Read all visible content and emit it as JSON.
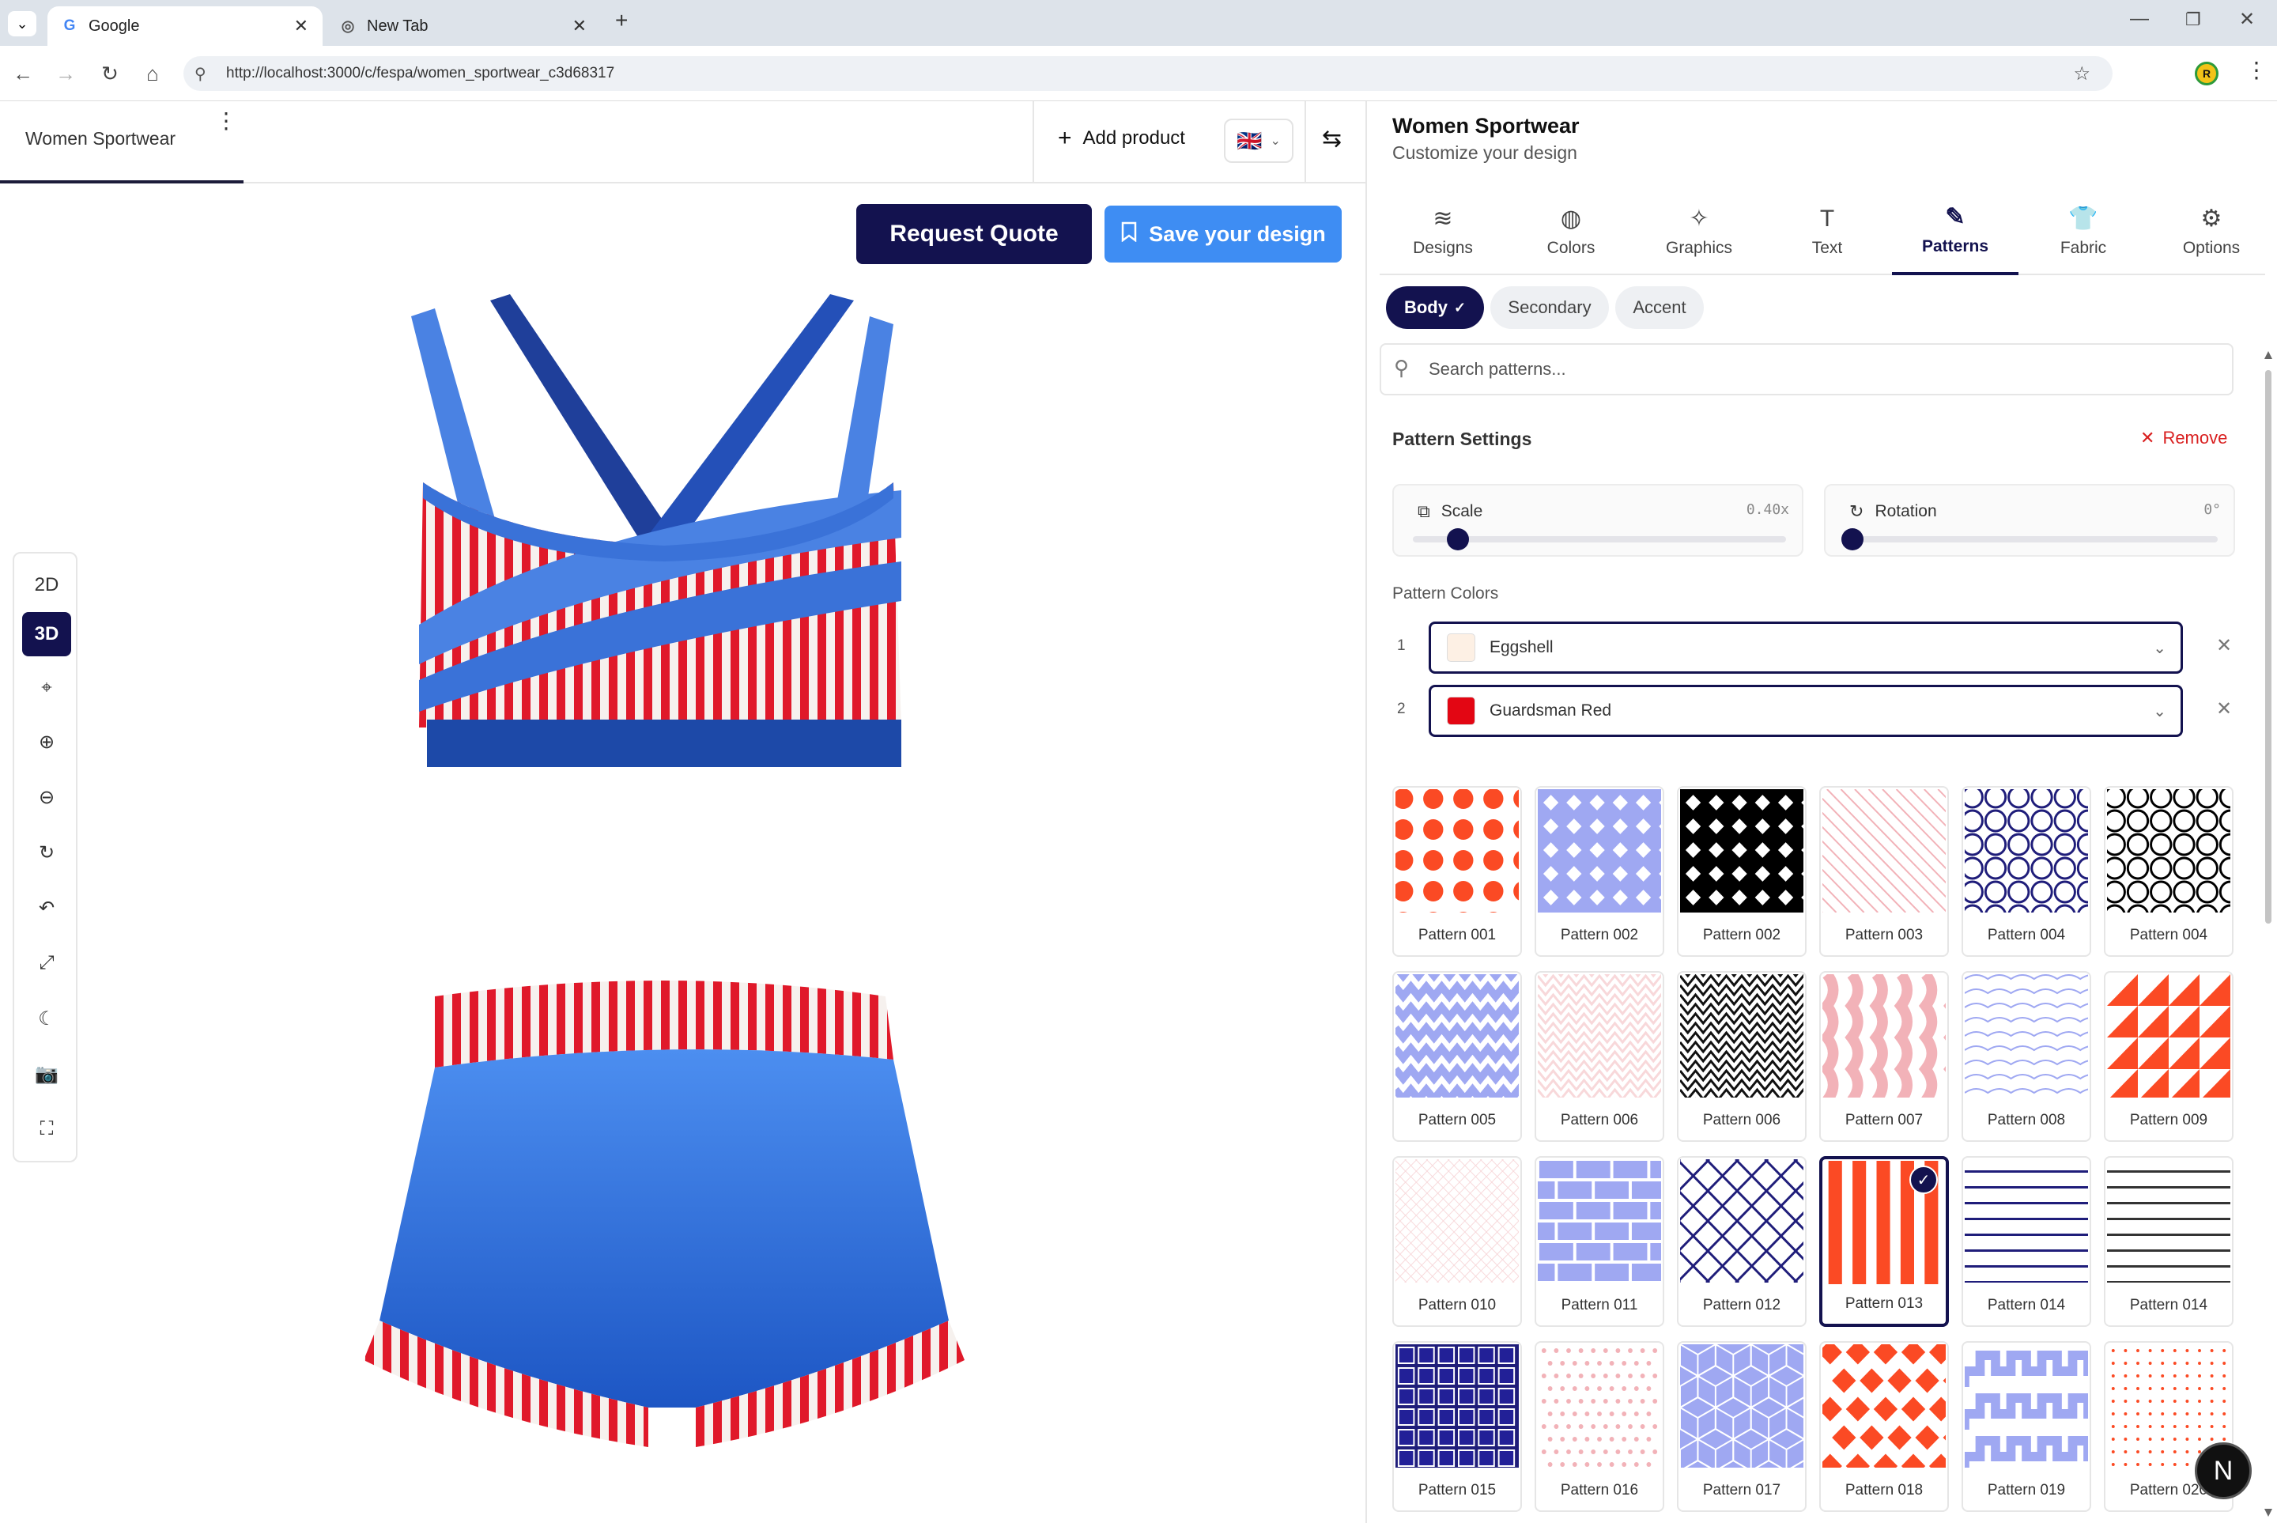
{
  "browser": {
    "tabs": [
      {
        "title": "Google",
        "active": true
      },
      {
        "title": "New Tab",
        "active": false
      }
    ],
    "url": "http://localhost:3000/c/fespa/women_sportwear_c3d68317"
  },
  "app": {
    "left_tab": "Women Sportwear",
    "add_product": "Add product",
    "language_flag": "🇬🇧",
    "request_quote": "Request Quote",
    "save_design": "Save your design",
    "view_modes": [
      "2D",
      "3D"
    ],
    "active_view": "3D"
  },
  "panel": {
    "title": "Women Sportwear",
    "subtitle": "Customize your design",
    "tabs": [
      {
        "label": "Designs",
        "icon": "layers-icon",
        "glyph": "≋"
      },
      {
        "label": "Colors",
        "icon": "palette-icon",
        "glyph": "◍"
      },
      {
        "label": "Graphics",
        "icon": "sparkles-icon",
        "glyph": "✧"
      },
      {
        "label": "Text",
        "icon": "text-icon",
        "glyph": "T"
      },
      {
        "label": "Patterns",
        "icon": "pen-tool-icon",
        "glyph": "✎"
      },
      {
        "label": "Fabric",
        "icon": "shirt-icon",
        "glyph": "👕"
      },
      {
        "label": "Options",
        "icon": "sliders-icon",
        "glyph": "⚙"
      }
    ],
    "active_tab": "Patterns",
    "zones": [
      "Body",
      "Secondary",
      "Accent"
    ],
    "active_zone": "Body",
    "search_placeholder": "Search patterns...",
    "pattern_settings_label": "Pattern Settings",
    "remove_label": "Remove",
    "scale": {
      "label": "Scale",
      "value_text": "0.40x",
      "fraction": 0.12
    },
    "rotation": {
      "label": "Rotation",
      "value_text": "0°",
      "fraction": 0.0
    },
    "pattern_colors_label": "Pattern Colors",
    "pattern_colors": [
      {
        "index": "1",
        "name": "Eggshell",
        "hex": "#fdf0e4"
      },
      {
        "index": "2",
        "name": "Guardsman Red",
        "hex": "#e30613"
      }
    ],
    "patterns": [
      {
        "label": "Pattern 001",
        "kind": "dots-red"
      },
      {
        "label": "Pattern 002",
        "kind": "diamond-lilac"
      },
      {
        "label": "Pattern 002",
        "kind": "diamond-black"
      },
      {
        "label": "Pattern 003",
        "kind": "diag-pink"
      },
      {
        "label": "Pattern 004",
        "kind": "circles-navy"
      },
      {
        "label": "Pattern 004",
        "kind": "circles-black"
      },
      {
        "label": "Pattern 005",
        "kind": "chevron-lilac"
      },
      {
        "label": "Pattern 006",
        "kind": "chevron-pink"
      },
      {
        "label": "Pattern 006",
        "kind": "chevron-black"
      },
      {
        "label": "Pattern 007",
        "kind": "wave-pink"
      },
      {
        "label": "Pattern 008",
        "kind": "wave-lilac"
      },
      {
        "label": "Pattern 009",
        "kind": "triangles-red"
      },
      {
        "label": "Pattern 010",
        "kind": "grid-pink"
      },
      {
        "label": "Pattern 011",
        "kind": "bricks-lilac"
      },
      {
        "label": "Pattern 012",
        "kind": "lattice-navy"
      },
      {
        "label": "Pattern 013",
        "kind": "stripes-red",
        "selected": true
      },
      {
        "label": "Pattern 014",
        "kind": "hlines-navy"
      },
      {
        "label": "Pattern 014",
        "kind": "hlines-black"
      },
      {
        "label": "Pattern 015",
        "kind": "grid-navy"
      },
      {
        "label": "Pattern 016",
        "kind": "dots-pink"
      },
      {
        "label": "Pattern 017",
        "kind": "cubes-lilac"
      },
      {
        "label": "Pattern 018",
        "kind": "diamonds-red"
      },
      {
        "label": "Pattern 019",
        "kind": "meander-lilac"
      },
      {
        "label": "Pattern 020",
        "kind": "dots-small-red"
      }
    ]
  },
  "colors": {
    "navy": "#13124f",
    "blue": "#3e8df3",
    "garment_blue": "#3477e0",
    "garment_red": "#e0192a",
    "danger": "#d92020"
  }
}
